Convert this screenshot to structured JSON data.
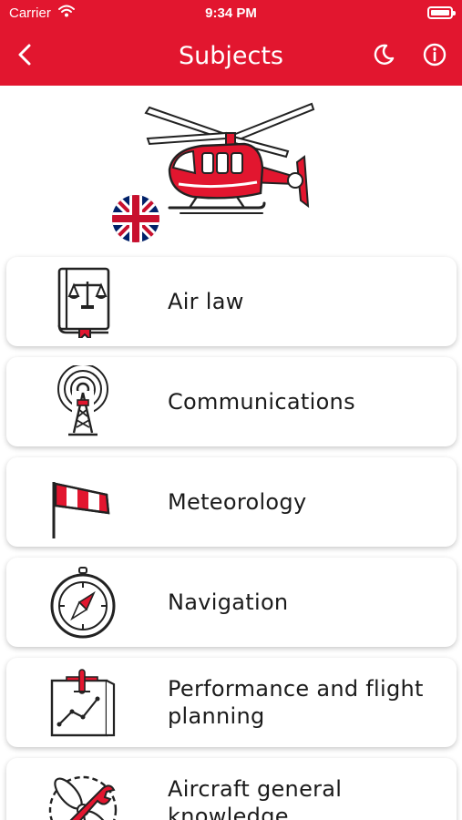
{
  "status_bar": {
    "carrier": "Carrier",
    "time": "9:34 PM"
  },
  "nav": {
    "title": "Subjects"
  },
  "hero": {
    "language": "English",
    "aircraft": "helicopter"
  },
  "colors": {
    "accent": "#e2162f",
    "text": "#1b1b1b",
    "card_bg": "#ffffff"
  },
  "subjects": [
    {
      "label": "Air law",
      "icon": "law-book-icon"
    },
    {
      "label": "Communications",
      "icon": "radio-tower-icon"
    },
    {
      "label": "Meteorology",
      "icon": "windsock-icon"
    },
    {
      "label": "Navigation",
      "icon": "compass-icon"
    },
    {
      "label": "Performance and flight planning",
      "icon": "flight-chart-icon"
    },
    {
      "label": "Aircraft general knowledge",
      "icon": "propeller-wrench-icon"
    }
  ]
}
